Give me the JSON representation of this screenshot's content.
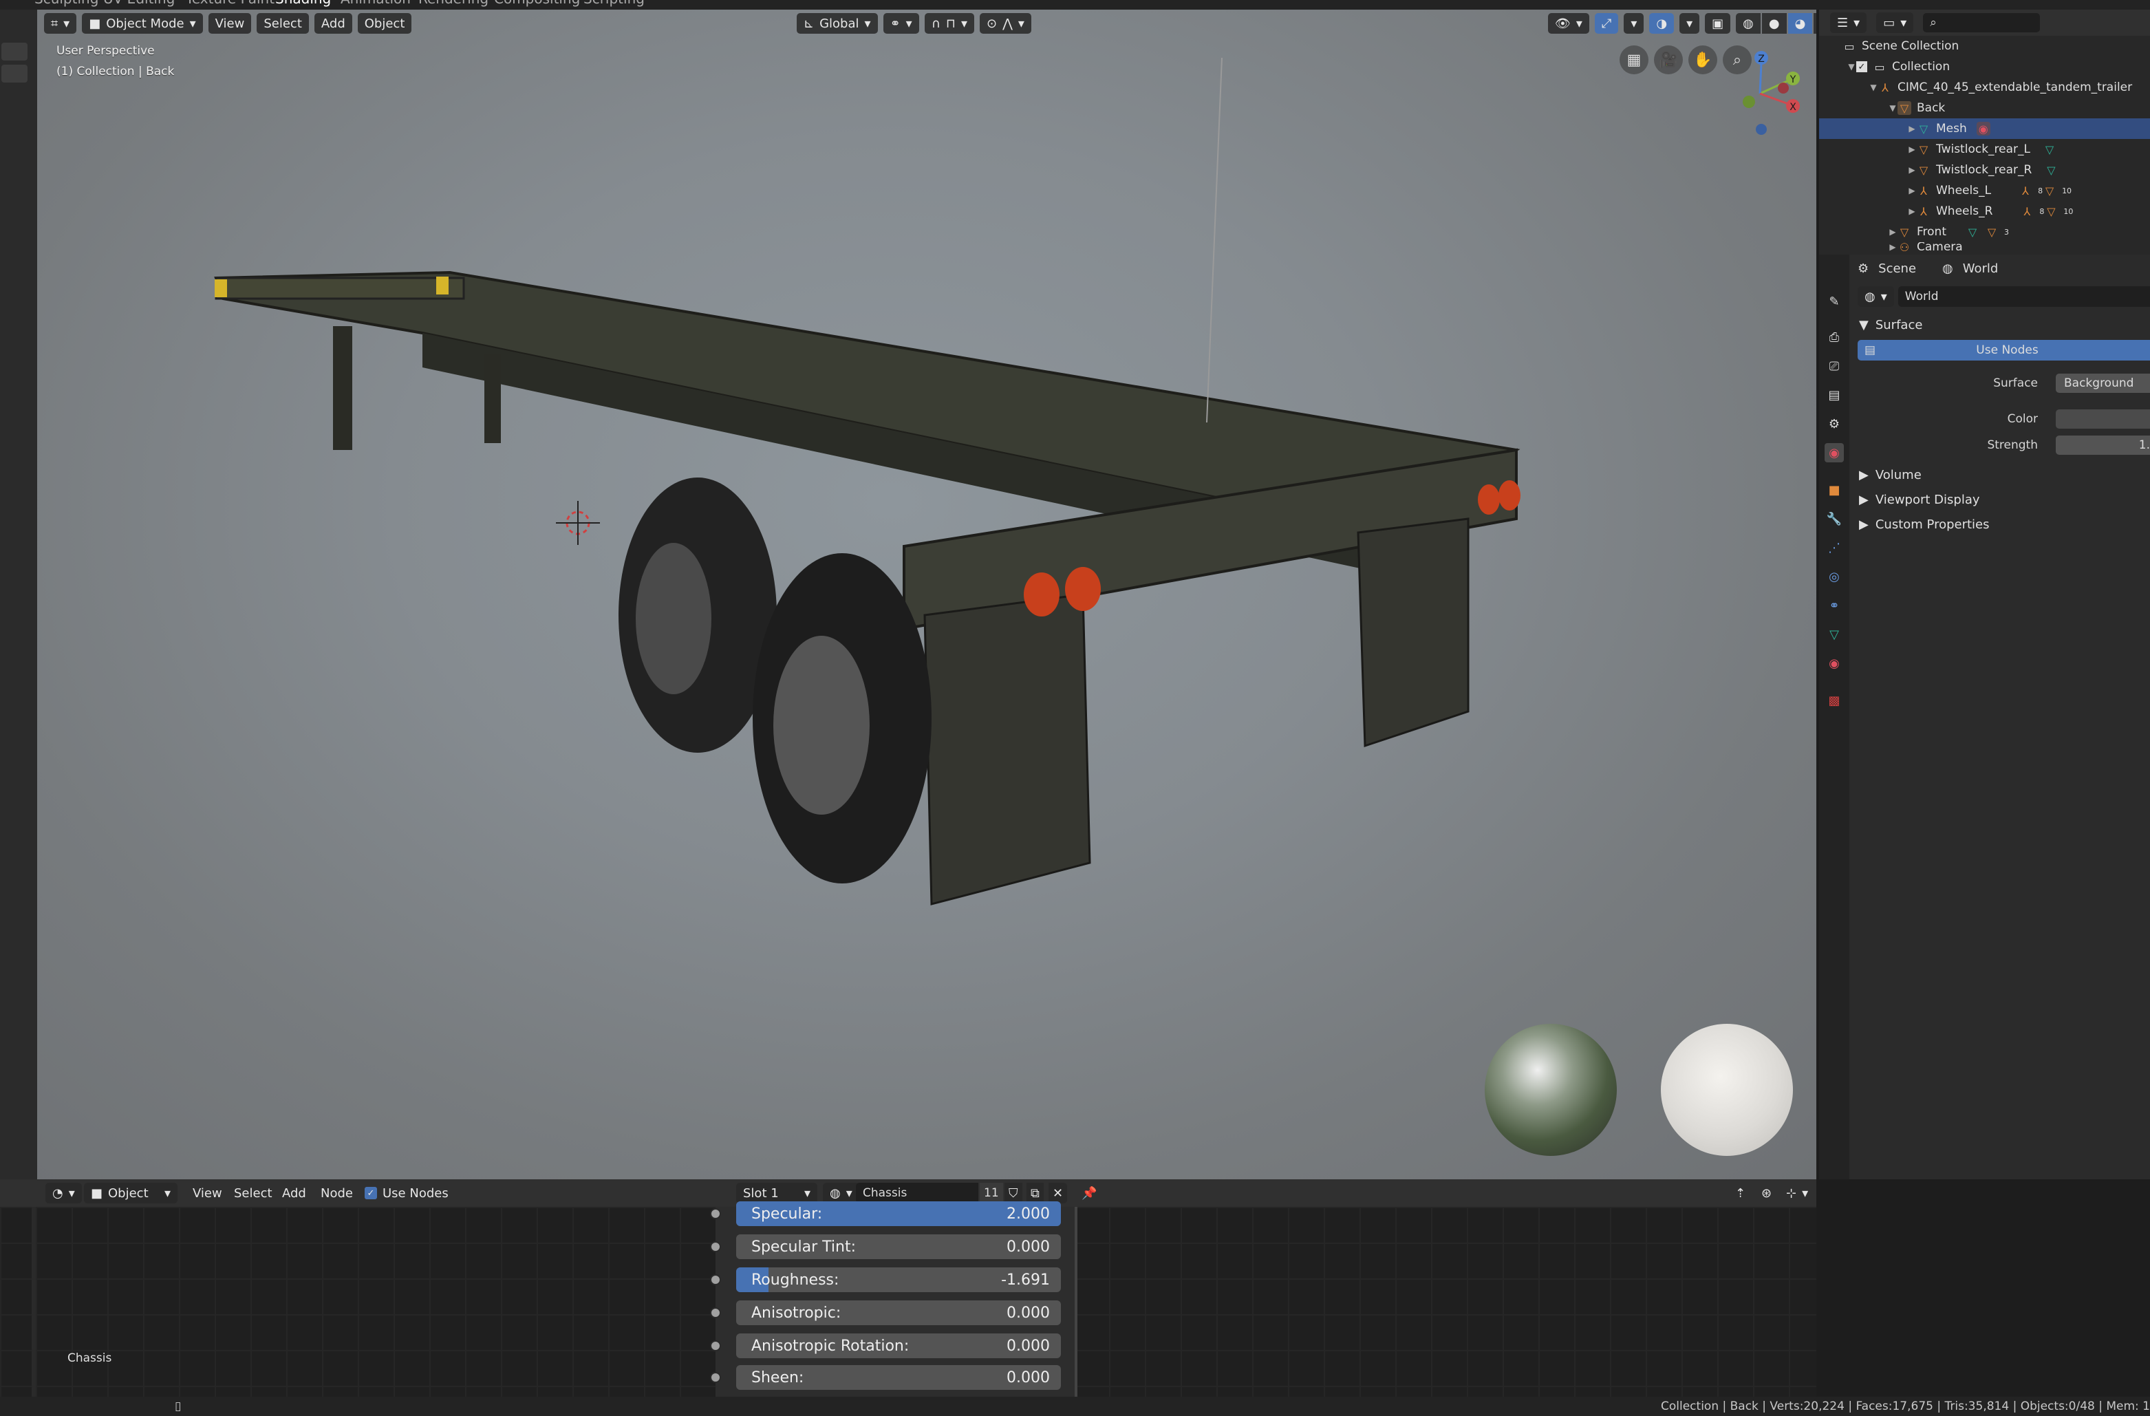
{
  "workspaces": [
    "Sculpting",
    "UV Editing",
    "Texture Paint",
    "Shading",
    "Animation",
    "Rendering",
    "Compositing",
    "Scripting"
  ],
  "viewport": {
    "mode": "Object Mode",
    "menus": [
      "View",
      "Select",
      "Add",
      "Object"
    ],
    "orientation": "Global",
    "overlay_title": "User Perspective",
    "overlay_sub": "(1) Collection | Back",
    "gizmo": {
      "x": "X",
      "y": "Y",
      "z": "Z"
    }
  },
  "outliner": {
    "scene_collection": "Scene Collection",
    "collection": "Collection",
    "armature": "CIMC_40_45_extendable_tandem_trailer",
    "back": "Back",
    "mesh": "Mesh",
    "twistlock_l": "Twistlock_rear_L",
    "twistlock_r": "Twistlock_rear_R",
    "wheels_l": "Wheels_L",
    "wheels_r": "Wheels_R",
    "front": "Front",
    "camera": "Camera",
    "badge_8": "8",
    "badge_10": "10",
    "badge_3": "3"
  },
  "properties": {
    "tab_scene": "Scene",
    "tab_world": "World",
    "world_name": "World",
    "surface_panel": "Surface",
    "use_nodes": "Use Nodes",
    "surface_label": "Surface",
    "surface_value": "Background",
    "color_label": "Color",
    "strength_label": "Strength",
    "strength_value": "1.",
    "volume": "Volume",
    "viewport_display": "Viewport Display",
    "custom_properties": "Custom Properties"
  },
  "node_editor": {
    "type": "Object",
    "menus": [
      "View",
      "Select",
      "Add",
      "Node"
    ],
    "use_nodes": "Use Nodes",
    "slot": "Slot 1",
    "material": "Chassis",
    "users": "11",
    "frame_label": "Chassis",
    "sockets": [
      {
        "label": "Specular:",
        "value": "2.000",
        "fill": 1.0
      },
      {
        "label": "Specular Tint:",
        "value": "0.000",
        "fill": 0.0
      },
      {
        "label": "Roughness:",
        "value": "-1.691",
        "fill": 0.1
      },
      {
        "label": "Anisotropic:",
        "value": "0.000",
        "fill": 0.0
      },
      {
        "label": "Anisotropic Rotation:",
        "value": "0.000",
        "fill": 0.0
      },
      {
        "label": "Sheen:",
        "value": "0.000",
        "fill": 0.0
      }
    ]
  },
  "status": "Collection | Back | Verts:20,224 | Faces:17,675 | Tris:35,814 | Objects:0/48 | Mem: 1",
  "colors": {
    "accent": "#4772b3",
    "selection": "#334d80",
    "panel": "#2b2b2b",
    "orange": "#e08a3c",
    "green": "#2fb49a"
  }
}
